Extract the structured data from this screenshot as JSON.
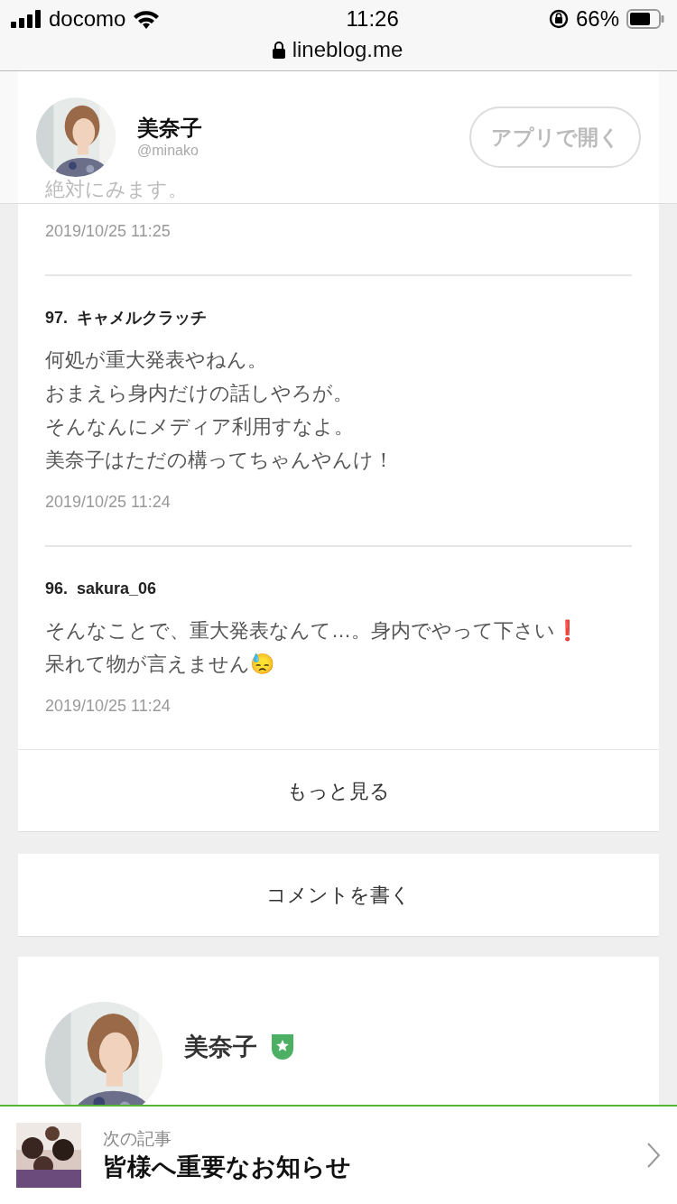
{
  "status_bar": {
    "carrier": "docomo",
    "time": "11:26",
    "battery": "66%"
  },
  "url": "lineblog.me",
  "header": {
    "name": "美奈子",
    "handle": "@minako",
    "open_button": "アプリで開く"
  },
  "comments": [
    {
      "lines": [
        "絶対にみます。"
      ],
      "date": "2019/10/25 11:25"
    },
    {
      "author": "97.  キャメルクラッチ",
      "lines": [
        "何処が重大発表やねん。",
        "おまえら身内だけの話しやろが。",
        "そんなんにメディア利用すなよ。",
        "美奈子はただの構ってちゃんやんけ！"
      ],
      "date": "2019/10/25 11:24"
    },
    {
      "author": "96.  sakura_06",
      "lines": [
        "そんなことで、重大発表なんて…。身内でやって下さい❗",
        "呆れて物が言えません😓"
      ],
      "date": "2019/10/25 11:24"
    }
  ],
  "more_button": "もっと見る",
  "write_button": "コメントを書く",
  "profile": {
    "name": "美奈子",
    "verified": true
  },
  "next_article": {
    "label": "次の記事",
    "title": "皆様へ重要なお知らせ"
  }
}
